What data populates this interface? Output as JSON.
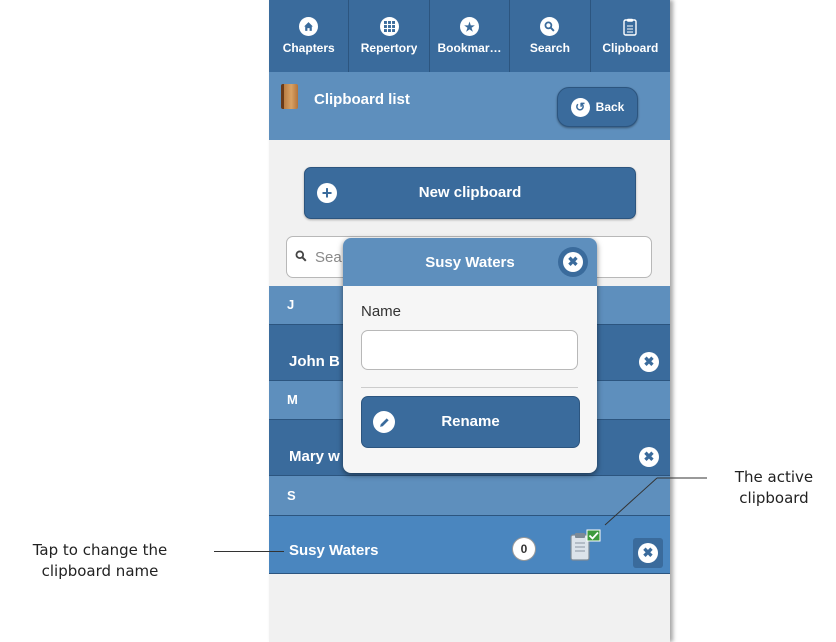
{
  "nav": {
    "items": [
      {
        "label": "Chapters",
        "icon": "home-icon"
      },
      {
        "label": "Repertory",
        "icon": "grid-icon"
      },
      {
        "label": "Bookmar…",
        "icon": "star-icon"
      },
      {
        "label": "Search",
        "icon": "search-icon"
      },
      {
        "label": "Clipboard",
        "icon": "clipboard-icon"
      }
    ]
  },
  "header": {
    "title": "Clipboard list",
    "back_label": "Back"
  },
  "main": {
    "new_clipboard_label": "New clipboard",
    "search_placeholder": "Sea",
    "sections": [
      {
        "letter": "J",
        "items": [
          {
            "name": "John B"
          }
        ]
      },
      {
        "letter": "M",
        "items": [
          {
            "name": "Mary w"
          }
        ]
      },
      {
        "letter": "S",
        "items": [
          {
            "name": "Susy Waters",
            "count": "0",
            "active": true
          }
        ]
      }
    ]
  },
  "dialog": {
    "title": "Susy Waters",
    "field_label": "Name",
    "field_value": "",
    "rename_label": "Rename"
  },
  "annotations": {
    "left_line1": "Tap to change the",
    "left_line2": "clipboard name",
    "right_line1": "The active",
    "right_line2": "clipboard"
  },
  "colors": {
    "primary": "#3a6b9c",
    "header": "#5e8fbd",
    "active_row": "#4a86bf",
    "background": "#f1f1f1"
  }
}
